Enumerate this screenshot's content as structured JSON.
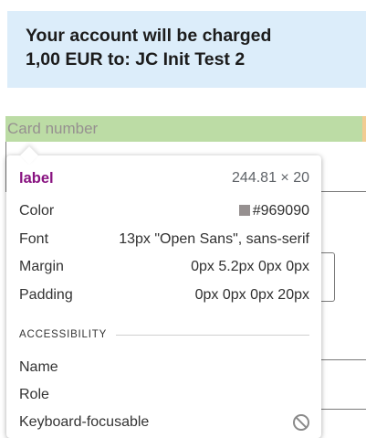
{
  "notice": {
    "line1": "Your account will be charged",
    "line2": "1,00 EUR to: JC Init Test 2"
  },
  "form": {
    "card_number_label": "Card number"
  },
  "tooltip": {
    "element_tag": "label",
    "dimensions": "244.81 × 20",
    "color_label": "Color",
    "color_value": "#969090",
    "font_label": "Font",
    "font_value": "13px \"Open Sans\", sans-serif",
    "margin_label": "Margin",
    "margin_value": "0px 5.2px 0px 0px",
    "padding_label": "Padding",
    "padding_value": "0px 0px 0px 20px",
    "accessibility_heading": "ACCESSIBILITY",
    "name_label": "Name",
    "role_label": "Role",
    "keyboard_label": "Keyboard-focusable",
    "keyboard_icon": "not-allowed-icon"
  },
  "colors": {
    "notice_bg": "#dcedfa",
    "highlight_bg": "#bcdca5",
    "tag_color": "#881280",
    "swatch": "#969090"
  }
}
